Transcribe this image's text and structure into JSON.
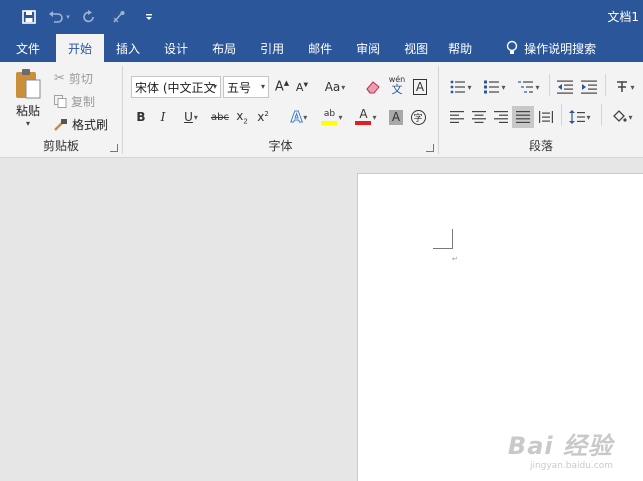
{
  "title_bar": {
    "doc_title": "文档1"
  },
  "tabs": [
    {
      "label": "文件"
    },
    {
      "label": "开始"
    },
    {
      "label": "插入"
    },
    {
      "label": "设计"
    },
    {
      "label": "布局"
    },
    {
      "label": "引用"
    },
    {
      "label": "邮件"
    },
    {
      "label": "审阅"
    },
    {
      "label": "视图"
    },
    {
      "label": "帮助"
    }
  ],
  "tell_me": "操作说明搜索",
  "clipboard": {
    "paste": "粘贴",
    "cut": "剪切",
    "copy": "复制",
    "format_painter": "格式刷",
    "group": "剪贴板"
  },
  "font": {
    "name": "宋体 (中文正文",
    "size": "五号",
    "aa_label": "Aa",
    "wen": "wén",
    "wen_char": "文",
    "group": "字体"
  },
  "paragraph": {
    "group": "段落"
  },
  "watermark": {
    "text": "Bai 经验",
    "url": "jingyan.baidu.com"
  },
  "colors": {
    "brand": "#2b579a",
    "ribbon_bg": "#f3f3f3",
    "font_color": "#e02020",
    "highlight": "#ffff00"
  }
}
